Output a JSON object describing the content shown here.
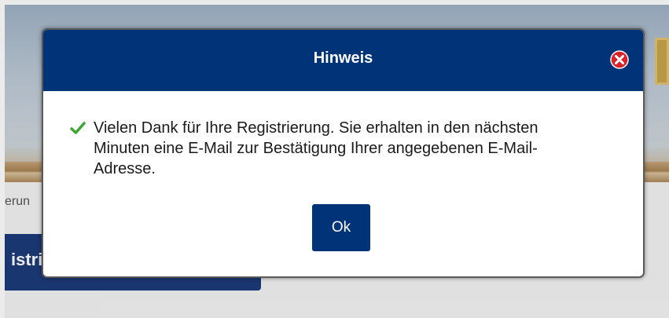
{
  "background": {
    "breadcrumb_fragment": "erun",
    "button_fragment": "istri"
  },
  "dialog": {
    "title": "Hinweis",
    "close_icon": "close-circle-red-icon",
    "status_icon": "check-green-icon",
    "message": "Vielen Dank für Ihre Registrierung. Sie erhalten in den nächsten Minuten eine E-Mail zur Bestätigung Ihrer angegebenen E-Mail-Adresse.",
    "ok_label": "Ok"
  },
  "colors": {
    "header": "#003378",
    "ok_button": "#003378",
    "close_icon": "#d9222a",
    "check_icon": "#3ea534"
  }
}
